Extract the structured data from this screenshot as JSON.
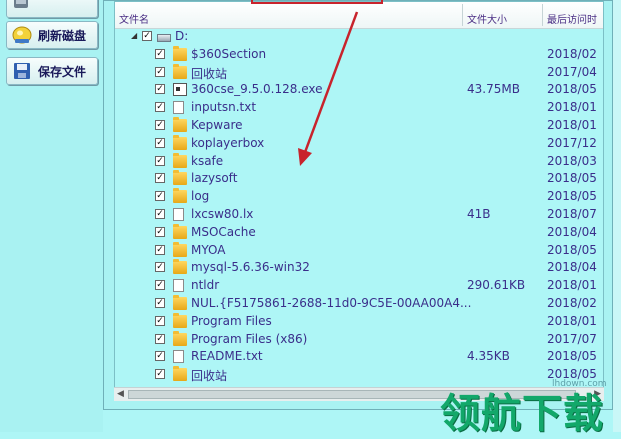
{
  "sidebar": {
    "buttons": [
      {
        "label": "刷新磁盘",
        "icon": "refresh-disk-icon"
      },
      {
        "label": "保存文件",
        "icon": "save-file-icon"
      }
    ]
  },
  "list": {
    "headers": {
      "name": "文件名",
      "size": "文件大小",
      "date": "最后访问时"
    },
    "root": {
      "label": "D:",
      "icon": "drive-icon"
    },
    "items": [
      {
        "name": "$360Section",
        "type": "folder",
        "size": "",
        "date": "2018/02"
      },
      {
        "name": "回收站",
        "type": "folder",
        "size": "",
        "date": "2017/04"
      },
      {
        "name": "360cse_9.5.0.128.exe",
        "type": "exe",
        "size": "43.75MB",
        "date": "2018/05"
      },
      {
        "name": "inputsn.txt",
        "type": "file",
        "size": "",
        "date": "2018/01"
      },
      {
        "name": "Kepware",
        "type": "folder",
        "size": "",
        "date": "2018/01"
      },
      {
        "name": "koplayerbox",
        "type": "folder",
        "size": "",
        "date": "2017/12"
      },
      {
        "name": "ksafe",
        "type": "folder",
        "size": "",
        "date": "2018/03"
      },
      {
        "name": "lazysoft",
        "type": "folder",
        "size": "",
        "date": "2018/05"
      },
      {
        "name": "log",
        "type": "folder",
        "size": "",
        "date": "2018/05"
      },
      {
        "name": "lxcsw80.lx",
        "type": "file",
        "size": "41B",
        "date": "2018/07"
      },
      {
        "name": "MSOCache",
        "type": "folder",
        "size": "",
        "date": "2018/04"
      },
      {
        "name": "MYOA",
        "type": "folder",
        "size": "",
        "date": "2018/05"
      },
      {
        "name": "mysql-5.6.36-win32",
        "type": "folder",
        "size": "",
        "date": "2018/04"
      },
      {
        "name": "ntldr",
        "type": "file",
        "size": "290.61KB",
        "date": "2018/01"
      },
      {
        "name": "NUL.{F5175861-2688-11d0-9C5E-00AA00A4...",
        "type": "folder",
        "size": "",
        "date": "2018/02"
      },
      {
        "name": "Program Files",
        "type": "folder",
        "size": "",
        "date": "2018/01"
      },
      {
        "name": "Program Files (x86)",
        "type": "folder",
        "size": "",
        "date": "2017/07"
      },
      {
        "name": "README.txt",
        "type": "file",
        "size": "4.35KB",
        "date": "2018/05"
      },
      {
        "name": "回收站",
        "type": "folder",
        "size": "",
        "date": "2018/05"
      }
    ]
  },
  "colors": {
    "background": "#aef6f6",
    "text": "#3a2e8a",
    "arrow": "#c8232c",
    "watermark": "#12a86a"
  },
  "watermark": {
    "small": "lhdown.com",
    "big": "领航下载"
  }
}
